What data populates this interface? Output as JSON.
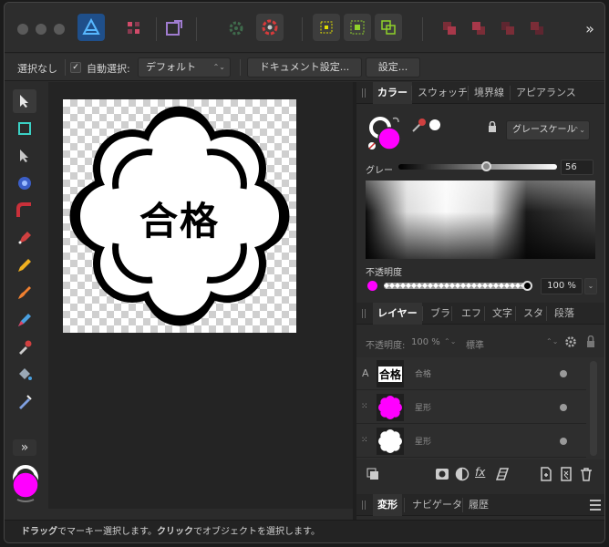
{
  "context_bar": {
    "selection": "選択なし",
    "auto_select_label": "自動選択:",
    "auto_select_value": "デフォルト",
    "document_settings": "ドキュメント設定...",
    "settings": "設定..."
  },
  "canvas": {
    "stamp_text": "合格"
  },
  "color_panel": {
    "tabs": [
      "カラー",
      "スウォッチ",
      "境界線",
      "アピアランス"
    ],
    "mode": "グレースケール",
    "gray_label": "グレー",
    "gray_value": "56",
    "opacity_label": "不透明度",
    "opacity_value": "100 %",
    "fill_color": "#ff00ff",
    "gray_fraction": 0.56
  },
  "layers_panel": {
    "tabs": [
      "レイヤー",
      "ブラ",
      "エフ",
      "文字",
      "スタ",
      "段落"
    ],
    "opacity_label": "不透明度:",
    "opacity_value": "100 %",
    "blend_mode": "標準",
    "layers": [
      {
        "type_icon": "A",
        "thumb_text": "合格",
        "name": "合格"
      },
      {
        "type_icon": "star-shape",
        "name": "星形",
        "color": "#ff00ff"
      },
      {
        "type_icon": "star-shape",
        "name": "星形",
        "color": "#ffffff"
      }
    ]
  },
  "transform_panel": {
    "tabs": [
      "変形",
      "ナビゲータ",
      "履歴"
    ]
  },
  "status": {
    "part1": "ドラッグ",
    "part2": "でマーキー選択します。",
    "part3": "クリック",
    "part4": "でオブジェクトを選択します。"
  },
  "tools": {
    "more": "»"
  }
}
